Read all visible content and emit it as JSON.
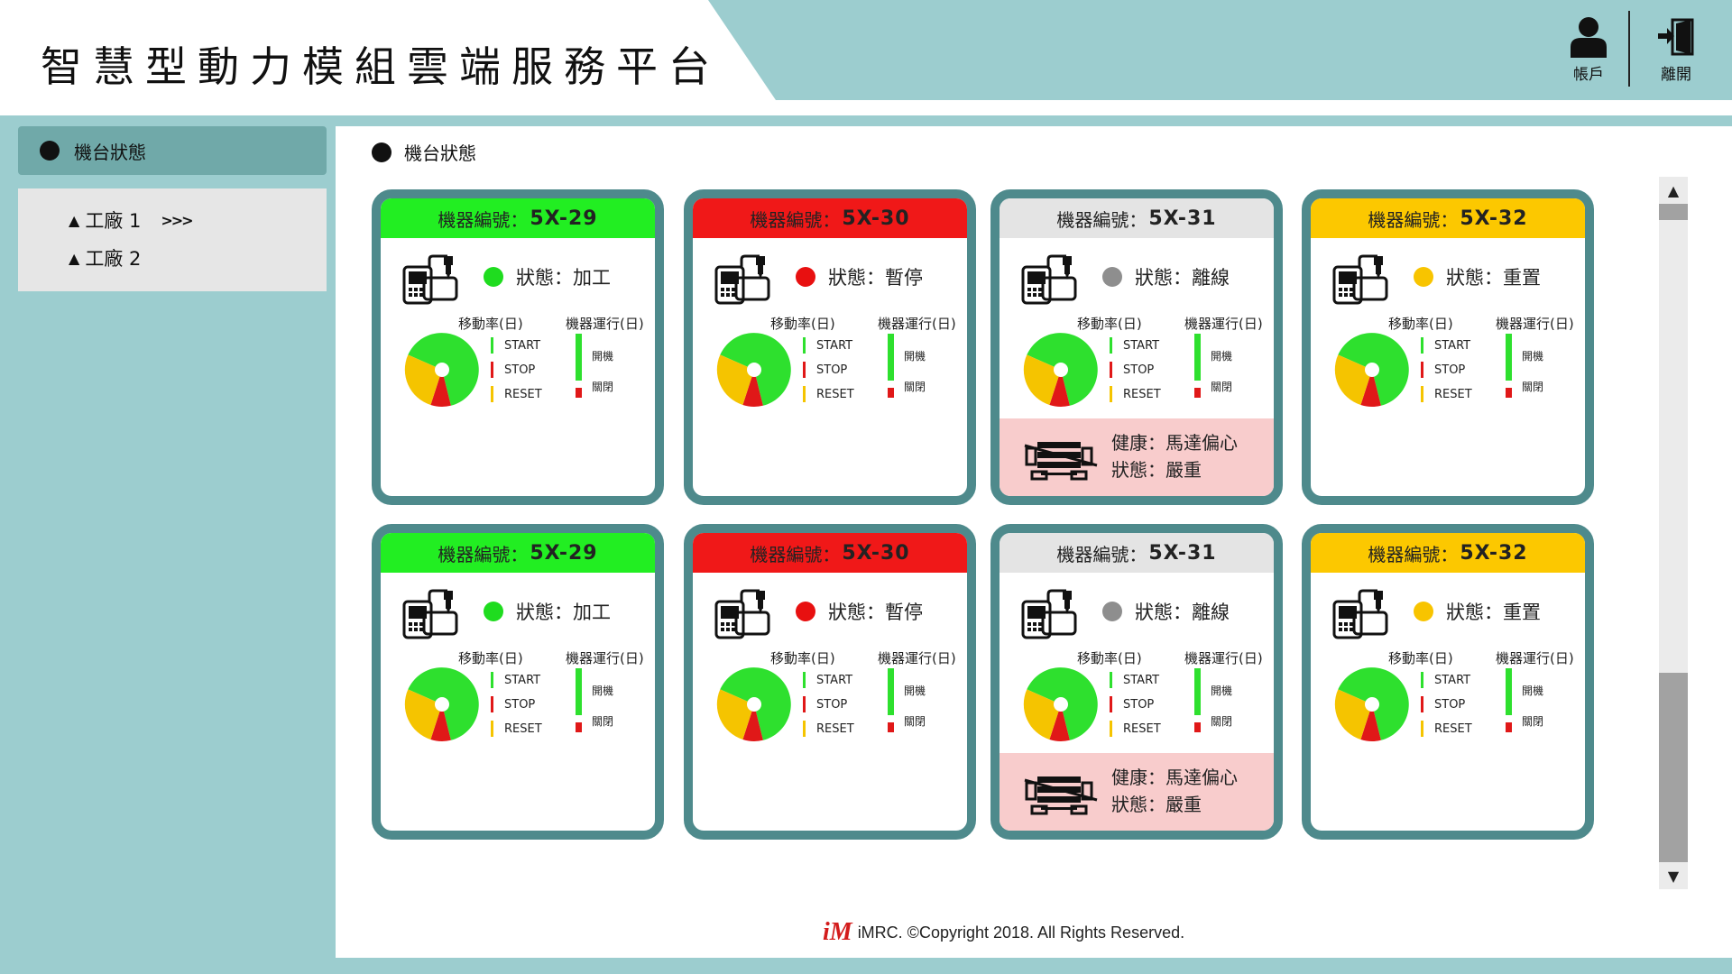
{
  "app": {
    "title": "智慧型動力模組雲端服務平台"
  },
  "header": {
    "account_label": "帳戶",
    "logout_label": "離開"
  },
  "sidebar": {
    "title": "機台狀態",
    "factories": [
      {
        "label": "工廠 1",
        "arrows": ">>>"
      },
      {
        "label": "工廠 2"
      }
    ]
  },
  "main": {
    "title": "機台狀態"
  },
  "labels": {
    "machine_id": "機器編號：",
    "status": "狀態：",
    "utilization": "移動率(日)",
    "runtime": "機器運行(日)",
    "start": "START",
    "stop": "STOP",
    "reset": "RESET",
    "on": "開機",
    "off": "關閉",
    "health_prefix": "健康：",
    "status_prefix": "狀態："
  },
  "machines": [
    {
      "id": "5X-29",
      "status": "加工",
      "head_color": "#22ee22",
      "dot_color": "#1fdc1f",
      "health": null
    },
    {
      "id": "5X-30",
      "status": "暫停",
      "head_color": "#f01818",
      "dot_color": "#e81010",
      "health": null
    },
    {
      "id": "5X-31",
      "status": "離線",
      "head_color": "#e4e4e4",
      "dot_color": "#8e8e8e",
      "health": {
        "issue": "馬達偏心",
        "severity": "嚴重"
      }
    },
    {
      "id": "5X-32",
      "status": "重置",
      "head_color": "#fcc800",
      "dot_color": "#f8c400",
      "health": null
    },
    {
      "id": "5X-29",
      "status": "加工",
      "head_color": "#22ee22",
      "dot_color": "#1fdc1f",
      "health": null
    },
    {
      "id": "5X-30",
      "status": "暫停",
      "head_color": "#f01818",
      "dot_color": "#e81010",
      "health": null
    },
    {
      "id": "5X-31",
      "status": "離線",
      "head_color": "#e4e4e4",
      "dot_color": "#8e8e8e",
      "health": {
        "issue": "馬達偏心",
        "severity": "嚴重"
      }
    },
    {
      "id": "5X-32",
      "status": "重置",
      "head_color": "#fcc800",
      "dot_color": "#f8c400",
      "health": null
    }
  ],
  "legend_colors": {
    "start": "#2ee02e",
    "stop": "#e01818",
    "reset": "#f5c400"
  },
  "footer": {
    "text": "iMRC. ©Copyright 2018. All Rights Reserved.",
    "logo": "iM"
  }
}
